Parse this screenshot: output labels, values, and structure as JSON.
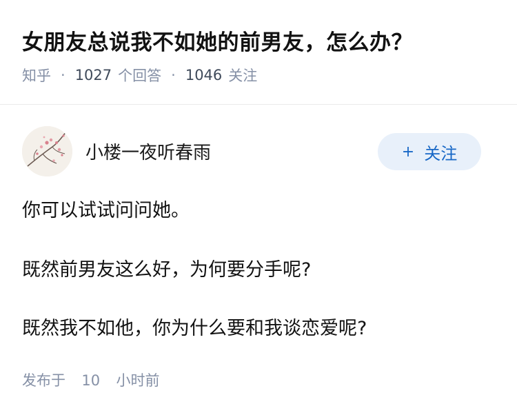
{
  "question": {
    "title": "女朋友总说我不如她的前男友，怎么办？",
    "source": "知乎",
    "answer_count": "1027",
    "answer_label": "个回答",
    "follower_count": "1046",
    "follower_label": "关注",
    "separator": "·"
  },
  "answer": {
    "author": {
      "name": "小楼一夜听春雨",
      "avatar_icon": "plum-blossom-avatar"
    },
    "follow_button": {
      "icon": "+",
      "label": "关注"
    },
    "paragraphs": [
      "你可以试试问问她。",
      "既然前男友这么好，为何要分手呢?",
      "既然我不如他，你为什么要和我谈恋爱呢?"
    ],
    "publish_prefix": "发布于",
    "publish_number": "10",
    "publish_suffix": "小时前"
  },
  "colors": {
    "meta_gray": "#8590a6",
    "follow_blue": "#1767c6",
    "follow_bg": "#e8f0fa"
  }
}
